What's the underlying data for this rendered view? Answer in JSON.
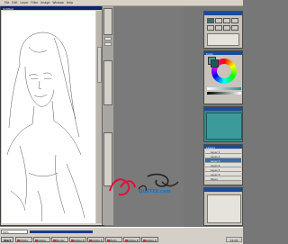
{
  "menubar": {
    "items": [
      "File",
      "Edit",
      "Layer",
      "Filter",
      "Image",
      "Window",
      "Help"
    ]
  },
  "document": {
    "title": "Untitled"
  },
  "panels": {
    "color_wheel_title": "Color",
    "layers_title": "Layers",
    "layer_rows": [
      "Layer 1",
      "Layer 2",
      "Layer 3",
      "Layer 4",
      "Layer 5",
      "Layer 6",
      "Paper"
    ]
  },
  "status": {
    "zoom": "50%"
  },
  "taskbar": {
    "start_label": "Start",
    "tasks": [
      "Adobe",
      "Adobe",
      "Painter",
      "Adobe P.",
      "Adobe P.",
      "Photo",
      "Adobe P.",
      "Adobe P."
    ],
    "clock": "21:04"
  },
  "watermark": {
    "text": "QUSTEE.com"
  },
  "colors": {
    "titlebar": "#0a246a",
    "canvas": "#ffffff",
    "panel_teal": "#2e8b8b",
    "workspace": "#7a7a7a"
  }
}
